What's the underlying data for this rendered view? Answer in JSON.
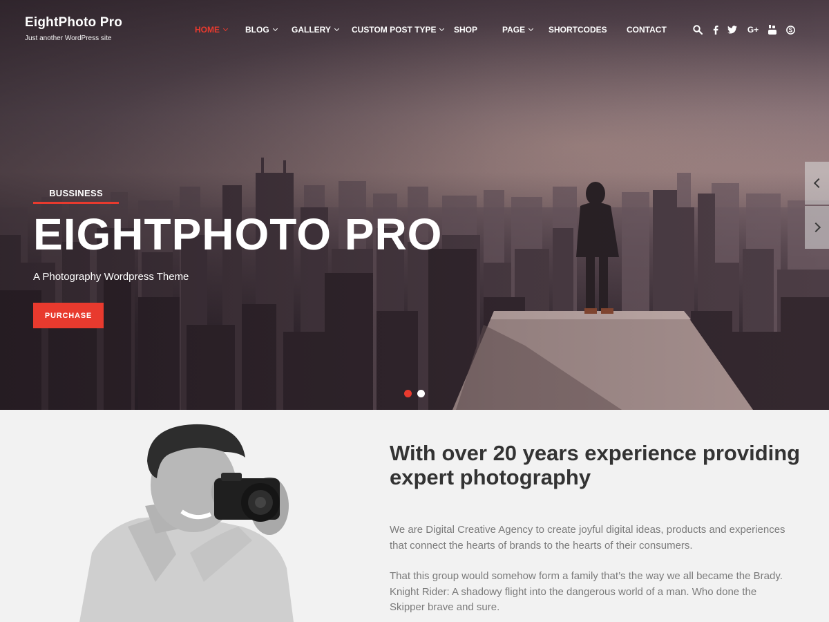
{
  "site": {
    "title": "EightPhoto Pro",
    "tagline": "Just another WordPress site"
  },
  "nav": {
    "items": [
      {
        "label": "HOME",
        "active": true,
        "dropdown": true
      },
      {
        "label": "BLOG",
        "active": false,
        "dropdown": true
      },
      {
        "label": "GALLERY",
        "active": false,
        "dropdown": true
      },
      {
        "label": "CUSTOM POST TYPE",
        "active": false,
        "dropdown": true
      },
      {
        "label": "SHOP",
        "active": false,
        "dropdown": false
      },
      {
        "label": "PAGE",
        "active": false,
        "dropdown": true
      },
      {
        "label": "SHORTCODES",
        "active": false,
        "dropdown": false
      },
      {
        "label": "CONTACT",
        "active": false,
        "dropdown": false
      }
    ],
    "social": {
      "search_icon": "search-icon",
      "facebook_icon": "facebook-icon",
      "twitter_icon": "twitter-icon",
      "google_plus_label": "G+",
      "youtube_icon": "youtube-icon",
      "skype_icon": "skype-icon"
    }
  },
  "hero": {
    "category": "BUSSINESS",
    "title": "EIGHTPHOTO PRO",
    "subtitle": "A Photography Wordpress Theme",
    "button_label": "PURCHASE",
    "slides": 2,
    "active_slide": 1
  },
  "about": {
    "heading": "With over 20 years experience providing expert photography",
    "paragraph1": "We are Digital Creative Agency to create joyful digital ideas, products and experiences that connect the hearts of brands to the hearts of their consumers.",
    "paragraph2": "That this group would somehow form a family that’s the way we all became the Brady. Knight Rider: A shadowy flight into the dangerous world of a man. Who done the Skipper brave and sure."
  },
  "colors": {
    "accent": "#e83a2e",
    "heading": "#333333",
    "body_text": "#7a7a7a",
    "section_bg": "#f2f2f2"
  }
}
